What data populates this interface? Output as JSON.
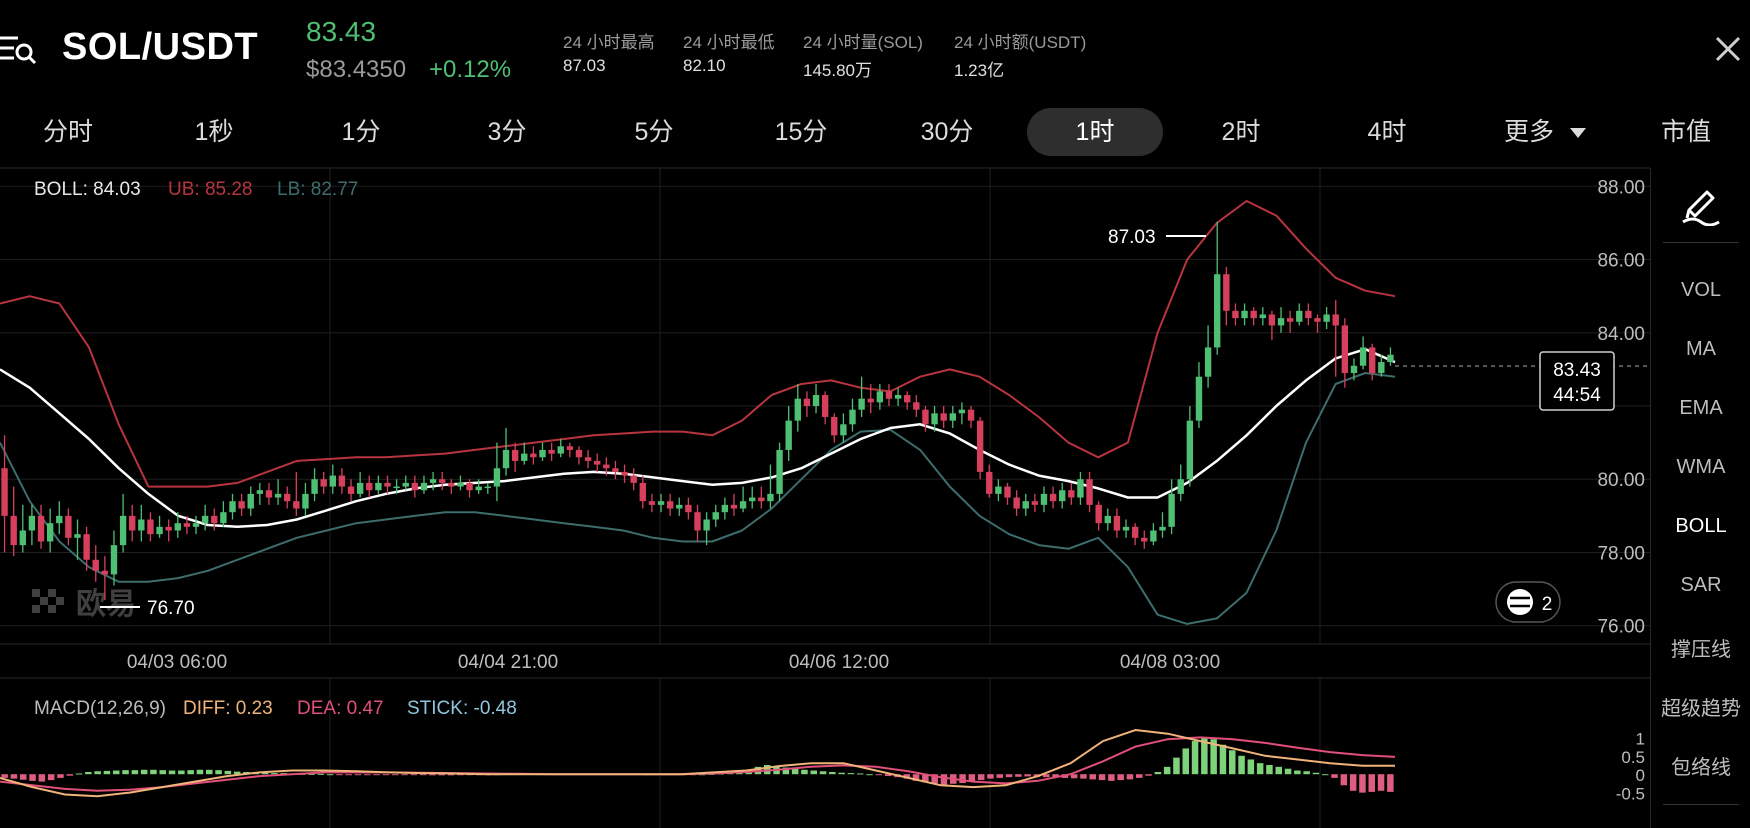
{
  "header": {
    "pair": "SOL/USDT",
    "last_price": "83.43",
    "usd_price": "$83.4350",
    "change_pct": "+0.12%",
    "stats": [
      {
        "label": "24 小时最高",
        "value": "87.03"
      },
      {
        "label": "24 小时最低",
        "value": "82.10"
      },
      {
        "label": "24 小时量(SOL)",
        "value": "145.80万"
      },
      {
        "label": "24 小时额(USDT)",
        "value": "1.23亿"
      }
    ]
  },
  "tabs": {
    "items": [
      "分时",
      "1秒",
      "1分",
      "3分",
      "5分",
      "15分",
      "30分",
      "1时",
      "2时",
      "4时",
      "更多",
      "市值"
    ],
    "active": "1时"
  },
  "sidebar": {
    "items": [
      "VOL",
      "MA",
      "EMA",
      "WMA",
      "BOLL",
      "SAR",
      "撑压线",
      "超级趋势",
      "包络线"
    ],
    "active": "BOLL"
  },
  "main_chart": {
    "boll_label": "BOLL: 84.03",
    "ub_label": "UB: 85.28",
    "lb_label": "LB: 82.77",
    "high_marker": "87.03",
    "low_marker": "76.70",
    "y_ticks": [
      "88.00",
      "86.00",
      "84.00",
      "80.00",
      "78.00",
      "76.00"
    ],
    "x_ticks": [
      "04/03 06:00",
      "04/04 21:00",
      "04/06 12:00",
      "04/08 03:00"
    ],
    "current_price": "83.43",
    "countdown": "44:54",
    "watermark": "欧易",
    "badge_count": "2"
  },
  "macd": {
    "title": "MACD(12,26,9)",
    "diff": "DIFF: 0.23",
    "dea": "DEA: 0.47",
    "stick": "STICK: -0.48",
    "y_ticks": [
      "1",
      "0.5",
      "0",
      "-0.5"
    ]
  },
  "colors": {
    "up": "#4fbf73",
    "down": "#d6405c",
    "ub": "#b8343f",
    "lb": "#3d6d6c",
    "mid": "#ffffff",
    "diff": "#f0b37a",
    "dea": "#e0507a",
    "stick": "#8fc6e0",
    "hist_up": "#7ed27a",
    "hist_down": "#e05d82"
  },
  "chart_data": {
    "type": "candlestick",
    "ylim": [
      75.5,
      88.5
    ],
    "candles": [
      [
        80.3,
        79.0,
        81.2,
        78.0
      ],
      [
        79.0,
        78.2,
        79.8,
        77.9
      ],
      [
        78.2,
        78.6,
        79.3,
        78.0
      ],
      [
        78.6,
        79.0,
        79.3,
        78.2
      ],
      [
        79.0,
        78.3,
        79.3,
        78.1
      ],
      [
        78.3,
        78.8,
        79.2,
        78.0
      ],
      [
        78.8,
        79.0,
        79.4,
        78.5
      ],
      [
        79.0,
        78.4,
        79.2,
        78.2
      ],
      [
        78.4,
        78.5,
        78.9,
        77.8
      ],
      [
        78.5,
        77.8,
        78.7,
        77.5
      ],
      [
        77.8,
        77.5,
        78.2,
        77.2
      ],
      [
        77.5,
        77.4,
        77.9,
        76.7
      ],
      [
        77.4,
        78.2,
        78.6,
        77.1
      ],
      [
        78.2,
        79.0,
        79.6,
        78.0
      ],
      [
        79.0,
        78.6,
        79.3,
        78.3
      ],
      [
        78.6,
        78.9,
        79.3,
        78.3
      ],
      [
        78.9,
        78.5,
        79.1,
        78.3
      ],
      [
        78.5,
        78.7,
        79.0,
        78.4
      ],
      [
        78.7,
        78.6,
        78.9,
        78.3
      ],
      [
        78.6,
        78.8,
        79.1,
        78.4
      ],
      [
        78.8,
        78.7,
        79.0,
        78.5
      ],
      [
        78.7,
        78.8,
        79.0,
        78.5
      ],
      [
        78.8,
        79.0,
        79.3,
        78.6
      ],
      [
        79.0,
        78.8,
        79.2,
        78.6
      ],
      [
        78.8,
        79.1,
        79.4,
        78.7
      ],
      [
        79.1,
        79.4,
        79.6,
        78.9
      ],
      [
        79.4,
        79.2,
        79.6,
        79.0
      ],
      [
        79.2,
        79.6,
        79.8,
        79.0
      ],
      [
        79.6,
        79.7,
        79.9,
        79.3
      ],
      [
        79.7,
        79.5,
        79.9,
        79.3
      ],
      [
        79.5,
        79.6,
        80.0,
        79.3
      ],
      [
        79.6,
        79.4,
        79.8,
        79.2
      ],
      [
        79.4,
        79.2,
        80.2,
        79.0
      ],
      [
        79.2,
        79.6,
        79.9,
        79.0
      ],
      [
        79.6,
        80.0,
        80.3,
        79.4
      ],
      [
        80.0,
        79.8,
        80.2,
        79.6
      ],
      [
        79.8,
        80.1,
        80.4,
        79.6
      ],
      [
        80.1,
        79.8,
        80.3,
        79.6
      ],
      [
        79.8,
        79.6,
        80.0,
        79.4
      ],
      [
        79.6,
        79.9,
        80.2,
        79.5
      ],
      [
        79.9,
        79.7,
        80.1,
        79.5
      ],
      [
        79.7,
        79.9,
        80.1,
        79.6
      ],
      [
        79.9,
        79.8,
        80.1,
        79.6
      ],
      [
        79.8,
        79.8,
        80.0,
        79.6
      ],
      [
        79.8,
        79.9,
        80.1,
        79.7
      ],
      [
        79.9,
        79.7,
        80.1,
        79.5
      ],
      [
        79.7,
        79.9,
        80.1,
        79.6
      ],
      [
        79.9,
        80.0,
        80.2,
        79.7
      ],
      [
        80.0,
        79.9,
        80.2,
        79.7
      ],
      [
        79.9,
        79.8,
        80.0,
        79.6
      ],
      [
        79.8,
        79.9,
        80.1,
        79.7
      ],
      [
        79.9,
        79.7,
        80.0,
        79.5
      ],
      [
        79.7,
        79.8,
        80.0,
        79.6
      ],
      [
        79.8,
        79.8,
        79.9,
        79.6
      ],
      [
        79.8,
        80.3,
        81.0,
        79.4
      ],
      [
        80.3,
        80.8,
        81.4,
        80.1
      ],
      [
        80.8,
        80.5,
        81.0,
        80.2
      ],
      [
        80.5,
        80.7,
        81.0,
        80.4
      ],
      [
        80.7,
        80.6,
        80.9,
        80.4
      ],
      [
        80.6,
        80.8,
        81.0,
        80.5
      ],
      [
        80.8,
        80.7,
        81.0,
        80.5
      ],
      [
        80.7,
        80.9,
        81.1,
        80.6
      ],
      [
        80.9,
        80.8,
        81.0,
        80.6
      ],
      [
        80.8,
        80.6,
        80.9,
        80.4
      ],
      [
        80.6,
        80.5,
        80.8,
        80.3
      ],
      [
        80.5,
        80.4,
        80.7,
        80.2
      ],
      [
        80.4,
        80.3,
        80.6,
        80.1
      ],
      [
        80.3,
        80.2,
        80.5,
        80.0
      ],
      [
        80.2,
        80.1,
        80.4,
        79.9
      ],
      [
        80.1,
        79.9,
        80.3,
        79.7
      ],
      [
        79.9,
        79.4,
        80.1,
        79.2
      ],
      [
        79.4,
        79.3,
        79.6,
        79.1
      ],
      [
        79.3,
        79.4,
        79.6,
        79.1
      ],
      [
        79.4,
        79.2,
        79.6,
        79.0
      ],
      [
        79.2,
        79.3,
        79.5,
        79.0
      ],
      [
        79.3,
        79.1,
        79.5,
        78.9
      ],
      [
        79.1,
        78.6,
        79.3,
        78.3
      ],
      [
        78.6,
        78.9,
        79.1,
        78.2
      ],
      [
        78.9,
        79.1,
        79.3,
        78.7
      ],
      [
        79.1,
        79.3,
        79.5,
        78.9
      ],
      [
        79.3,
        79.2,
        79.6,
        79.0
      ],
      [
        79.2,
        79.4,
        79.8,
        79.1
      ],
      [
        79.4,
        79.5,
        79.8,
        79.2
      ],
      [
        79.5,
        79.4,
        79.8,
        79.2
      ],
      [
        79.4,
        79.6,
        80.4,
        79.2
      ],
      [
        79.6,
        80.8,
        81.0,
        79.4
      ],
      [
        80.8,
        81.6,
        82.0,
        80.5
      ],
      [
        81.6,
        82.2,
        82.6,
        81.3
      ],
      [
        82.2,
        82.0,
        82.4,
        81.7
      ],
      [
        82.0,
        82.3,
        82.6,
        81.8
      ],
      [
        82.3,
        81.7,
        82.4,
        81.5
      ],
      [
        81.7,
        81.2,
        81.8,
        81.0
      ],
      [
        81.2,
        81.5,
        81.8,
        81.0
      ],
      [
        81.5,
        81.9,
        82.2,
        81.3
      ],
      [
        81.9,
        82.2,
        82.8,
        81.7
      ],
      [
        82.2,
        82.1,
        82.6,
        81.8
      ],
      [
        82.1,
        82.4,
        82.6,
        81.9
      ],
      [
        82.4,
        82.2,
        82.6,
        82.0
      ],
      [
        82.2,
        82.3,
        82.5,
        82.0
      ],
      [
        82.3,
        82.1,
        82.4,
        81.9
      ],
      [
        82.1,
        81.9,
        82.3,
        81.7
      ],
      [
        81.9,
        81.5,
        82.0,
        81.3
      ],
      [
        81.5,
        81.8,
        82.0,
        81.3
      ],
      [
        81.8,
        81.6,
        82.0,
        81.4
      ],
      [
        81.6,
        81.8,
        82.0,
        81.4
      ],
      [
        81.8,
        81.9,
        82.1,
        81.5
      ],
      [
        81.9,
        81.6,
        82.0,
        81.4
      ],
      [
        81.6,
        80.2,
        81.7,
        80.0
      ],
      [
        80.2,
        79.6,
        80.4,
        79.5
      ],
      [
        79.6,
        79.8,
        80.0,
        79.4
      ],
      [
        79.8,
        79.5,
        79.9,
        79.3
      ],
      [
        79.5,
        79.2,
        79.7,
        79.0
      ],
      [
        79.2,
        79.4,
        79.6,
        79.0
      ],
      [
        79.4,
        79.3,
        79.6,
        79.1
      ],
      [
        79.3,
        79.6,
        79.8,
        79.1
      ],
      [
        79.6,
        79.4,
        79.8,
        79.2
      ],
      [
        79.4,
        79.7,
        79.9,
        79.2
      ],
      [
        79.7,
        79.5,
        79.9,
        79.3
      ],
      [
        79.5,
        80.0,
        80.2,
        79.3
      ],
      [
        80.0,
        79.3,
        80.2,
        79.1
      ],
      [
        79.3,
        78.8,
        79.4,
        78.6
      ],
      [
        78.8,
        79.0,
        79.2,
        78.6
      ],
      [
        79.0,
        78.6,
        79.2,
        78.4
      ],
      [
        78.6,
        78.7,
        78.9,
        78.4
      ],
      [
        78.7,
        78.4,
        78.8,
        78.2
      ],
      [
        78.4,
        78.3,
        78.6,
        78.1
      ],
      [
        78.3,
        78.6,
        78.8,
        78.2
      ],
      [
        78.6,
        78.7,
        79.1,
        78.4
      ],
      [
        78.7,
        79.6,
        80.0,
        78.5
      ],
      [
        79.6,
        80.0,
        80.4,
        79.4
      ],
      [
        80.0,
        81.6,
        82.0,
        79.8
      ],
      [
        81.6,
        82.8,
        83.2,
        81.4
      ],
      [
        82.8,
        83.6,
        84.2,
        82.5
      ],
      [
        83.6,
        85.6,
        87.03,
        83.4
      ],
      [
        85.6,
        84.6,
        85.8,
        84.2
      ],
      [
        84.6,
        84.4,
        84.8,
        84.2
      ],
      [
        84.4,
        84.6,
        84.8,
        84.2
      ],
      [
        84.6,
        84.4,
        84.7,
        84.2
      ],
      [
        84.4,
        84.5,
        84.7,
        84.2
      ],
      [
        84.5,
        84.2,
        84.6,
        83.8
      ],
      [
        84.2,
        84.4,
        84.7,
        84.0
      ],
      [
        84.4,
        84.3,
        84.6,
        84.0
      ],
      [
        84.3,
        84.6,
        84.8,
        84.2
      ],
      [
        84.6,
        84.4,
        84.8,
        84.2
      ],
      [
        84.4,
        84.3,
        84.5,
        84.0
      ],
      [
        84.3,
        84.5,
        84.7,
        84.1
      ],
      [
        84.5,
        84.2,
        84.9,
        82.8
      ],
      [
        84.2,
        82.9,
        84.4,
        82.5
      ],
      [
        82.9,
        83.1,
        83.3,
        82.7
      ],
      [
        83.1,
        83.6,
        83.9,
        83.0
      ],
      [
        83.6,
        82.9,
        83.7,
        82.7
      ],
      [
        82.9,
        83.2,
        83.4,
        82.8
      ],
      [
        83.2,
        83.4,
        83.6,
        83.1
      ]
    ],
    "boll_mid": [
      83.0,
      82.5,
      81.8,
      81.1,
      80.3,
      79.6,
      79.0,
      78.75,
      78.7,
      78.75,
      78.9,
      79.15,
      79.4,
      79.6,
      79.75,
      79.85,
      79.9,
      79.95,
      80.05,
      80.15,
      80.2,
      80.15,
      80.05,
      79.95,
      79.85,
      79.9,
      80.05,
      80.3,
      80.7,
      81.1,
      81.4,
      81.5,
      81.25,
      80.8,
      80.4,
      80.1,
      79.95,
      79.75,
      79.5,
      79.5,
      79.9,
      80.5,
      81.2,
      82.0,
      82.7,
      83.3,
      83.55,
      83.2
    ],
    "boll_ub": [
      84.8,
      85.0,
      84.8,
      83.6,
      81.5,
      79.8,
      79.8,
      79.8,
      79.9,
      80.2,
      80.5,
      80.55,
      80.6,
      80.6,
      80.65,
      80.7,
      80.8,
      80.9,
      81.0,
      81.1,
      81.2,
      81.25,
      81.3,
      81.3,
      81.2,
      81.6,
      82.3,
      82.6,
      82.7,
      82.5,
      82.4,
      82.8,
      83.0,
      82.8,
      82.3,
      81.7,
      81.0,
      80.6,
      81.0,
      84.0,
      86.0,
      87.0,
      87.6,
      87.2,
      86.3,
      85.5,
      85.15,
      85.0
    ],
    "boll_lb": [
      81.0,
      79.4,
      78.3,
      77.6,
      77.2,
      77.2,
      77.3,
      77.5,
      77.8,
      78.1,
      78.4,
      78.6,
      78.8,
      78.9,
      79.0,
      79.1,
      79.1,
      79.0,
      78.9,
      78.8,
      78.7,
      78.6,
      78.4,
      78.3,
      78.3,
      78.6,
      79.2,
      80.0,
      80.8,
      81.3,
      81.35,
      80.8,
      79.8,
      79.0,
      78.5,
      78.2,
      78.1,
      78.4,
      77.6,
      76.3,
      76.05,
      76.2,
      76.9,
      78.6,
      81.0,
      82.6,
      82.9,
      82.8
    ],
    "x_labels": [
      "04/03 06:00",
      "04/04 21:00",
      "04/06 12:00",
      "04/08 03:00"
    ],
    "macd_ylim": [
      -0.7,
      1.2
    ],
    "macd_hist": [
      -0.1,
      -0.12,
      -0.15,
      -0.18,
      -0.2,
      -0.16,
      -0.1,
      -0.04,
      0.02,
      0.06,
      0.08,
      0.09,
      0.1,
      0.11,
      0.11,
      0.12,
      0.12,
      0.11,
      0.1,
      0.1,
      0.11,
      0.12,
      0.12,
      0.11,
      0.09,
      0.07,
      0.06,
      0.05,
      0.04,
      0.03,
      0.03,
      0.02,
      0.01,
      0.01,
      0.01,
      0.0,
      -0.01,
      -0.01,
      -0.01,
      -0.02,
      -0.02,
      -0.01,
      -0.01,
      -0.01,
      -0.02,
      -0.02,
      -0.03,
      -0.03,
      -0.03,
      -0.02,
      -0.02,
      -0.01,
      -0.01,
      -0.01,
      0.01,
      0.02,
      0.02,
      0.02,
      0.02,
      0.02,
      0.02,
      0.02,
      0.02,
      0.02,
      0.02,
      0.01,
      0.01,
      0.01,
      0.01,
      0.0,
      -0.01,
      -0.01,
      -0.01,
      -0.01,
      -0.01,
      0.0,
      0.01,
      0.02,
      0.03,
      0.05,
      0.12,
      0.2,
      0.25,
      0.22,
      0.18,
      0.15,
      0.12,
      0.1,
      0.08,
      0.06,
      0.04,
      0.03,
      0.02,
      0.0,
      -0.02,
      -0.05,
      -0.08,
      -0.12,
      -0.18,
      -0.22,
      -0.25,
      -0.28,
      -0.26,
      -0.24,
      -0.2,
      -0.16,
      -0.12,
      -0.1,
      -0.08,
      -0.07,
      -0.06,
      -0.07,
      -0.08,
      -0.09,
      -0.1,
      -0.11,
      -0.12,
      -0.14,
      -0.16,
      -0.18,
      -0.16,
      -0.14,
      -0.1,
      -0.04,
      0.06,
      0.2,
      0.45,
      0.7,
      0.9,
      1.0,
      0.95,
      0.8,
      0.65,
      0.5,
      0.4,
      0.3,
      0.25,
      0.2,
      0.15,
      0.1,
      0.08,
      0.04,
      0.0,
      -0.1,
      -0.3,
      -0.45,
      -0.5,
      -0.48,
      -0.45,
      -0.48
    ],
    "macd_diff": [
      -0.1,
      -0.35,
      -0.55,
      -0.6,
      -0.5,
      -0.35,
      -0.2,
      -0.05,
      0.05,
      0.1,
      0.1,
      0.08,
      0.05,
      0.03,
      0.02,
      0.0,
      0.0,
      0.0,
      0.0,
      0.0,
      0.0,
      0.0,
      0.05,
      0.1,
      0.22,
      0.3,
      0.3,
      0.1,
      -0.1,
      -0.3,
      -0.35,
      -0.3,
      -0.05,
      0.3,
      0.9,
      1.2,
      1.1,
      0.9,
      0.7,
      0.5,
      0.4,
      0.3,
      0.23,
      0.23
    ],
    "macd_dea": [
      -0.2,
      -0.3,
      -0.4,
      -0.45,
      -0.42,
      -0.35,
      -0.25,
      -0.15,
      -0.05,
      0.0,
      0.05,
      0.05,
      0.05,
      0.04,
      0.03,
      0.02,
      0.01,
      0.0,
      0.0,
      0.0,
      0.0,
      0.0,
      0.02,
      0.06,
      0.12,
      0.2,
      0.24,
      0.2,
      0.08,
      -0.08,
      -0.2,
      -0.25,
      -0.18,
      0.0,
      0.35,
      0.75,
      0.95,
      1.0,
      0.95,
      0.85,
      0.72,
      0.6,
      0.52,
      0.47
    ]
  }
}
